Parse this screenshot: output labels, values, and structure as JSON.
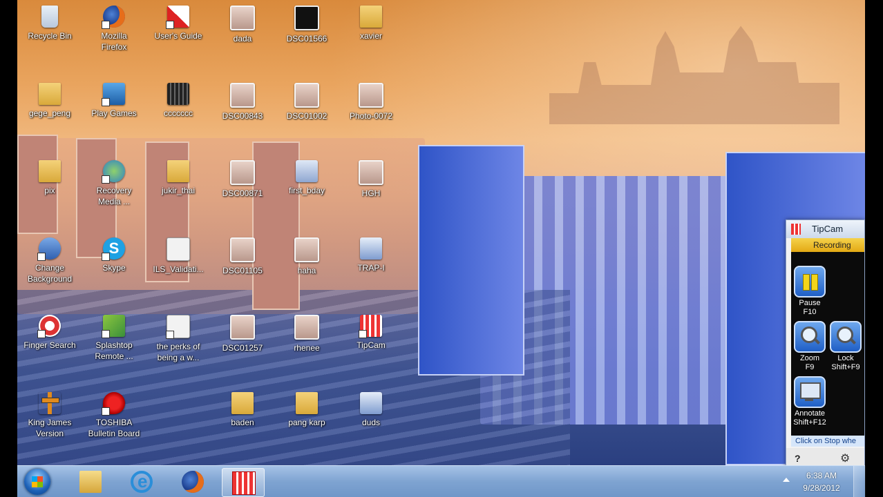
{
  "desktop": {
    "icons": [
      {
        "label": "Recycle Bin"
      },
      {
        "label": "Mozilla\nFirefox"
      },
      {
        "label": "User's Guide"
      },
      {
        "label": "dada"
      },
      {
        "label": "DSC01566"
      },
      {
        "label": "xavier"
      },
      {
        "label": "gege_peng"
      },
      {
        "label": "Play Games"
      },
      {
        "label": "ccccccc"
      },
      {
        "label": "DSC00843"
      },
      {
        "label": "DSC01002"
      },
      {
        "label": "Photo-0072"
      },
      {
        "label": "pix"
      },
      {
        "label": "Recovery\nMedia ..."
      },
      {
        "label": "jukir_thai"
      },
      {
        "label": "DSC00871"
      },
      {
        "label": "first_bday"
      },
      {
        "label": "HGH"
      },
      {
        "label": "Change\nBackground"
      },
      {
        "label": "Skype"
      },
      {
        "label": "ILS_Validati..."
      },
      {
        "label": "DSC01105"
      },
      {
        "label": "haha"
      },
      {
        "label": "TRAP-I"
      },
      {
        "label": "Finger Search"
      },
      {
        "label": "Splashtop\nRemote ..."
      },
      {
        "label": "the perks of\nbeing a w..."
      },
      {
        "label": "DSC01257"
      },
      {
        "label": "rhenee"
      },
      {
        "label": "TipCam"
      },
      {
        "label": "King James\nVersion"
      },
      {
        "label": "TOSHIBA\nBulletin Board"
      },
      {
        "label": "baden"
      },
      {
        "label": "pang karp"
      },
      {
        "label": "duds"
      }
    ]
  },
  "tipcam": {
    "title": "TipCam",
    "status": "Recording",
    "pause": {
      "label": "Pause",
      "shortcut": "F10"
    },
    "zoom": {
      "label": "Zoom",
      "shortcut": "F9"
    },
    "lock": {
      "label": "Lock",
      "shortcut": "Shift+F9"
    },
    "annotate": {
      "label": "Annotate",
      "shortcut": "Shift+F12"
    },
    "hint": "Click on Stop whe",
    "help": "?"
  },
  "taskbar": {
    "time": "6:38 AM",
    "date": "9/28/2012"
  },
  "skype_glyph": "S",
  "settings_glyph": "⚙"
}
